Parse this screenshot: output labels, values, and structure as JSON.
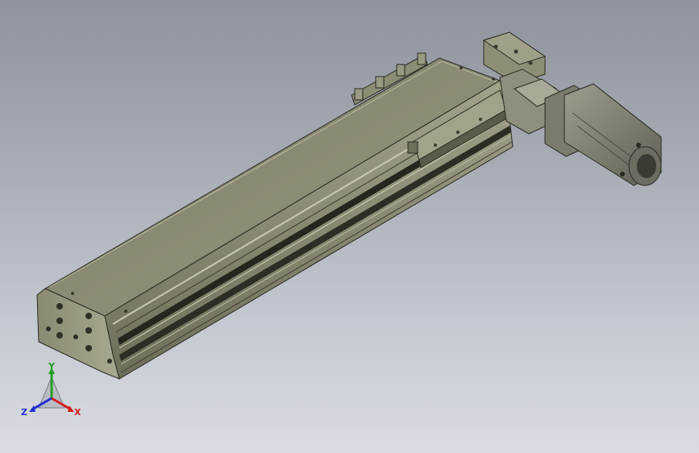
{
  "scene": {
    "background_top": "#8e939c",
    "background_bottom": "#d9dce2",
    "model_color": "#8d8c74",
    "model_dark": "#5b5a4a",
    "motor_color": "#7f8071"
  },
  "triad": {
    "x_label": "X",
    "y_label": "Y",
    "z_label": "Z",
    "x_color": "#d42020",
    "y_color": "#22a022",
    "z_color": "#2030d0"
  }
}
